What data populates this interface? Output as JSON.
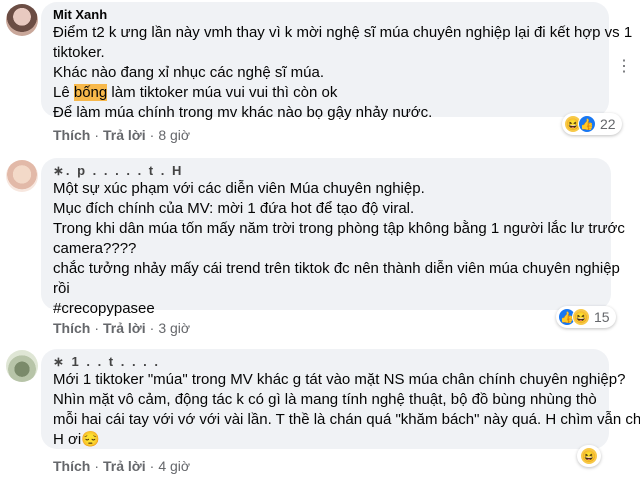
{
  "comments": [
    {
      "author": "Mit Xanh",
      "lines": [
        "Điểm t2 k ưng lần này vmh thay vì k mời nghệ sĩ múa chuyên nghiệp lại đi kết hợp vs 1",
        "tiktoker.",
        "Khác nào đang xỉ nhục các nghệ sĩ múa.",
        "",
        "Để làm múa chính trong mv khác nào bọ gậy nhảy nước."
      ],
      "line4_pre": "Lê ",
      "line4_highlight": "bống",
      "line4_post": " làm tiktoker múa vui vui thì còn ok",
      "like_label": "Thích",
      "reply_label": "Trả lời",
      "time": "8 giờ",
      "reaction_count": "22"
    },
    {
      "author": "∗. p . . . . . t . H",
      "lines": [
        "Một sự xúc phạm với các diễn viên Múa chuyên nghiệp.",
        "Mục đích chính của MV: mời 1 đứa hot để tạo độ viral.",
        "Trong khi dân múa tốn mấy năm trời trong phòng tập không bằng 1 người lắc lư trước",
        "camera????",
        "chắc tưởng nhảy mấy cái trend trên tiktok đc nên thành diễn viên múa chuyên nghiệp",
        "rồi",
        "#crecopypasee"
      ],
      "like_label": "Thích",
      "reply_label": "Trả lời",
      "time": "3 giờ",
      "reaction_count": "15"
    },
    {
      "author": "∗ 1 . . t . . . .",
      "lines": [
        "Mới 1 tiktoker \"múa\" trong MV khác g tát vào mặt NS múa chân chính chuyên nghiệp?",
        "Nhìn mặt vô cảm, động tác k có gì là mang tính nghệ thuật, bộ đồ bùng nhùng thò",
        "mỗi hai cái tay với vớ với vài lần. T thề là chán quá \"khăm bách\" này quá. H chìm vẫn chìm",
        "H ơi😔"
      ],
      "like_label": "Thích",
      "reply_label": "Trả lời",
      "time": "4 giờ"
    }
  ],
  "icons": {
    "haha": "😆",
    "like": "👍",
    "more": "⋮"
  },
  "colors": {
    "bubble": "#f0f2f5",
    "meta": "#65676b",
    "highlight": "#f7b84b",
    "like_blue": "#1877f2"
  }
}
